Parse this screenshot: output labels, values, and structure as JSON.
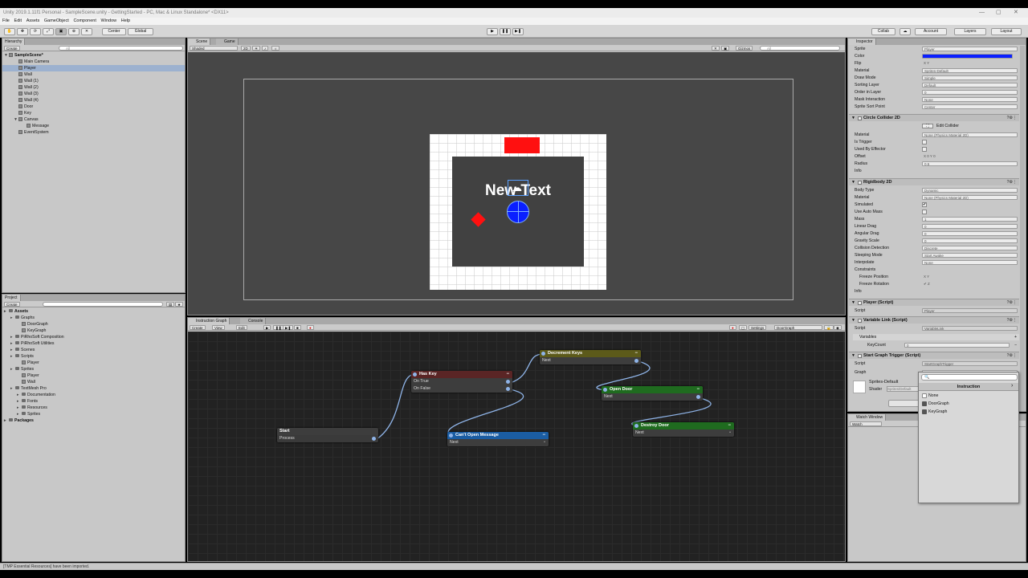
{
  "window": {
    "title": "Unity 2019.1.11f1 Personal - SampleScene.unity - GettingStarted - PC, Mac & Linux Standalone* <DX11>"
  },
  "menu": [
    "File",
    "Edit",
    "Assets",
    "GameObject",
    "Component",
    "Window",
    "Help"
  ],
  "toolbar": {
    "pivot_label": "Center",
    "space_label": "Global",
    "collab_label": "Collab",
    "account_label": "Account",
    "layers_label": "Layers",
    "layout_label": "Layout"
  },
  "hierarchy": {
    "tab": "Hierarchy",
    "create_label": "Create",
    "search_placeholder": "All",
    "scene_name": "SampleScene*",
    "items": [
      "Main Camera",
      "Player",
      "Wall",
      "Wall (1)",
      "Wall (2)",
      "Wall (3)",
      "Wall (4)",
      "Door",
      "Key",
      "Canvas",
      "Message",
      "EventSystem"
    ]
  },
  "scene": {
    "tabs": [
      "Scene",
      "Game"
    ],
    "shading": "Shaded",
    "mode_2d": "2D",
    "gizmos_label": "Gizmos",
    "search_placeholder": "All",
    "text_label": "New Text",
    "colors": {
      "background": "#474747",
      "wall": "#ffffff",
      "floor": "#414141",
      "door": "#ff1010",
      "key": "#ff1010",
      "player": "#0a1fff"
    }
  },
  "project": {
    "tab": "Project",
    "create_label": "Create",
    "items": [
      {
        "label": "Assets",
        "type": "folder",
        "depth": 0,
        "bold": true
      },
      {
        "label": "Graphs",
        "type": "folder",
        "depth": 1
      },
      {
        "label": "DoorGraph",
        "type": "file",
        "depth": 2
      },
      {
        "label": "KeyGraph",
        "type": "file",
        "depth": 2
      },
      {
        "label": "PiRhoSoft Composition",
        "type": "folder",
        "depth": 1
      },
      {
        "label": "PiRhoSoft Utilities",
        "type": "folder",
        "depth": 1
      },
      {
        "label": "Scenes",
        "type": "folder",
        "depth": 1
      },
      {
        "label": "Scripts",
        "type": "folder",
        "depth": 1
      },
      {
        "label": "Player",
        "type": "file",
        "depth": 2
      },
      {
        "label": "Sprites",
        "type": "folder",
        "depth": 1
      },
      {
        "label": "Player",
        "type": "file",
        "depth": 2
      },
      {
        "label": "Wall",
        "type": "file",
        "depth": 2
      },
      {
        "label": "TextMesh Pro",
        "type": "folder",
        "depth": 1
      },
      {
        "label": "Documentation",
        "type": "folder",
        "depth": 2
      },
      {
        "label": "Fonts",
        "type": "folder",
        "depth": 2
      },
      {
        "label": "Resources",
        "type": "folder",
        "depth": 2
      },
      {
        "label": "Sprites",
        "type": "folder",
        "depth": 2
      },
      {
        "label": "Packages",
        "type": "folder",
        "depth": 0,
        "bold": true
      }
    ]
  },
  "graph": {
    "tabs": [
      "Instruction Graph",
      "Console"
    ],
    "create_label": "Create",
    "view_label": "View",
    "edit_label": "Edit",
    "settings_label": "Settings",
    "graph_select": "DoorGraph",
    "nodes": {
      "start": {
        "title": "Start",
        "ports": [
          "Process"
        ],
        "color": "#2b2b2b"
      },
      "has_key": {
        "title": "Has Key",
        "ports": [
          "On True",
          "On False"
        ],
        "color": "#5a2525"
      },
      "decrement": {
        "title": "Decrement Keys",
        "ports": [
          "Next"
        ],
        "color": "#5c5a1a"
      },
      "open_door": {
        "title": "Open Door",
        "ports": [
          "Next"
        ],
        "color": "#1f6b1f"
      },
      "cant_open": {
        "title": "Can't Open Message",
        "ports": [
          "Next"
        ],
        "color": "#1b5da3"
      },
      "destroy": {
        "title": "Destroy Door",
        "ports": [
          "Next"
        ],
        "color": "#1f6b1f"
      }
    },
    "min_symbol": "−"
  },
  "inspector": {
    "tab": "Inspector",
    "sprite_renderer": [
      {
        "label": "Sprite",
        "value": "Player"
      },
      {
        "label": "Color",
        "value": ""
      },
      {
        "label": "Flip",
        "value": "X   Y"
      },
      {
        "label": "Material",
        "value": "Sprites-Default"
      },
      {
        "label": "Draw Mode",
        "value": "Simple"
      },
      {
        "label": "Sorting Layer",
        "value": "Default"
      },
      {
        "label": "Order in Layer",
        "value": "0"
      },
      {
        "label": "Mask Interaction",
        "value": "None"
      },
      {
        "label": "Sprite Sort Point",
        "value": "Center"
      }
    ],
    "sprite_color": "#0a1fff",
    "circle_collider": {
      "title": "Circle Collider 2D",
      "edit_label": "Edit Collider",
      "rows": [
        {
          "label": "Material",
          "value": "None (Physics Material 2D)"
        },
        {
          "label": "Is Trigger",
          "value": ""
        },
        {
          "label": "Used By Effector",
          "value": ""
        },
        {
          "label": "Offset",
          "value": "X 0          Y 0"
        },
        {
          "label": "Radius",
          "value": "0.5"
        },
        {
          "label": "Info",
          "value": ""
        }
      ]
    },
    "rigidbody": {
      "title": "Rigidbody 2D",
      "rows": [
        {
          "label": "Body Type",
          "value": "Dynamic"
        },
        {
          "label": "Material",
          "value": "None (Physics Material 2D)"
        },
        {
          "label": "Simulated",
          "value": "✔"
        },
        {
          "label": "Use Auto Mass",
          "value": ""
        },
        {
          "label": "Mass",
          "value": "1"
        },
        {
          "label": "Linear Drag",
          "value": "0"
        },
        {
          "label": "Angular Drag",
          "value": "0"
        },
        {
          "label": "Gravity Scale",
          "value": "0"
        },
        {
          "label": "Collision Detection",
          "value": "Discrete"
        },
        {
          "label": "Sleeping Mode",
          "value": "Start Awake"
        },
        {
          "label": "Interpolate",
          "value": "None"
        },
        {
          "label": "Constraints",
          "value": ""
        },
        {
          "label": "Freeze Position",
          "value": "X   Y"
        },
        {
          "label": "Freeze Rotation",
          "value": "✔ Z"
        },
        {
          "label": "Info",
          "value": ""
        }
      ]
    },
    "player_script": {
      "title": "Player (Script)",
      "script_label": "Script",
      "script_value": "Player"
    },
    "variable_link": {
      "title": "Variable Link (Script)",
      "script_label": "Script",
      "script_value": "VariableLink",
      "variables_label": "Variables",
      "var_name": "KeyCount",
      "var_value": "0"
    },
    "start_graph": {
      "title": "Start Graph Trigger (Script)",
      "script_label": "Script",
      "script_value": "StartGraphTrigger",
      "graph_label": "Graph",
      "graph_value": "None"
    },
    "material_preview": {
      "name": "Sprites-Default",
      "shader_label": "Shader",
      "shader_value": "Sprites/Default"
    },
    "add_component_label": "Add Component",
    "watch_window_tab": "Watch Window",
    "watch_label": "Watch"
  },
  "picker": {
    "header": "Instruction",
    "items": [
      "None",
      "DoorGraph",
      "KeyGraph"
    ]
  },
  "status": {
    "message": "[TMP Essential Resources] have been imported."
  }
}
